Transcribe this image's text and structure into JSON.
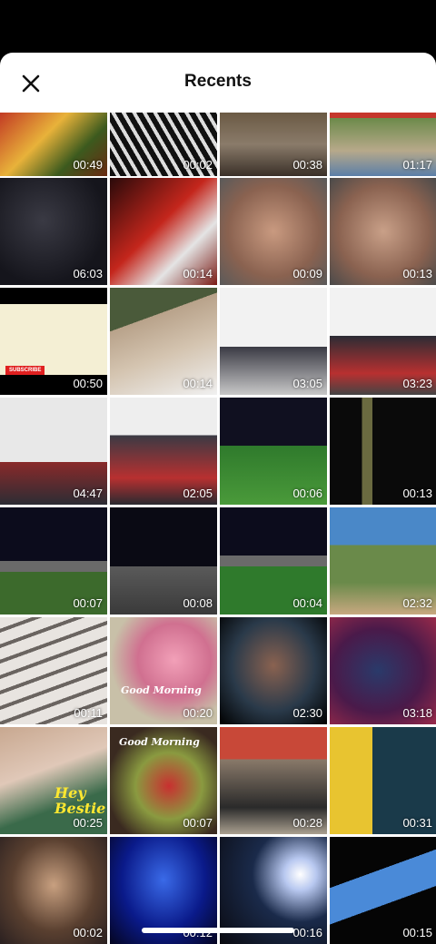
{
  "header": {
    "title": "Recents",
    "close_icon": "close-icon"
  },
  "videos": [
    {
      "duration": "00:49"
    },
    {
      "duration": "00:02"
    },
    {
      "duration": "00:38"
    },
    {
      "duration": "01:17"
    },
    {
      "duration": "06:03"
    },
    {
      "duration": "00:14"
    },
    {
      "duration": "00:09"
    },
    {
      "duration": "00:13"
    },
    {
      "duration": "00:50"
    },
    {
      "duration": "00:14"
    },
    {
      "duration": "03:05"
    },
    {
      "duration": "03:23"
    },
    {
      "duration": "04:47"
    },
    {
      "duration": "02:05"
    },
    {
      "duration": "00:06"
    },
    {
      "duration": "00:13"
    },
    {
      "duration": "00:07"
    },
    {
      "duration": "00:08"
    },
    {
      "duration": "00:04"
    },
    {
      "duration": "02:32"
    },
    {
      "duration": "00:11"
    },
    {
      "duration": "00:20"
    },
    {
      "duration": "02:30"
    },
    {
      "duration": "03:18"
    },
    {
      "duration": "00:25"
    },
    {
      "duration": "00:07"
    },
    {
      "duration": "00:28"
    },
    {
      "duration": "00:31"
    },
    {
      "duration": "00:02"
    },
    {
      "duration": "00:12"
    },
    {
      "duration": "00:16"
    },
    {
      "duration": "00:15"
    }
  ],
  "overlays": {
    "subscribe": "SUBSCRIBE",
    "hey_bestie": "Hey Bestie",
    "good_morning_1": "Good Morning",
    "good_morning_2": "Good Morning"
  }
}
